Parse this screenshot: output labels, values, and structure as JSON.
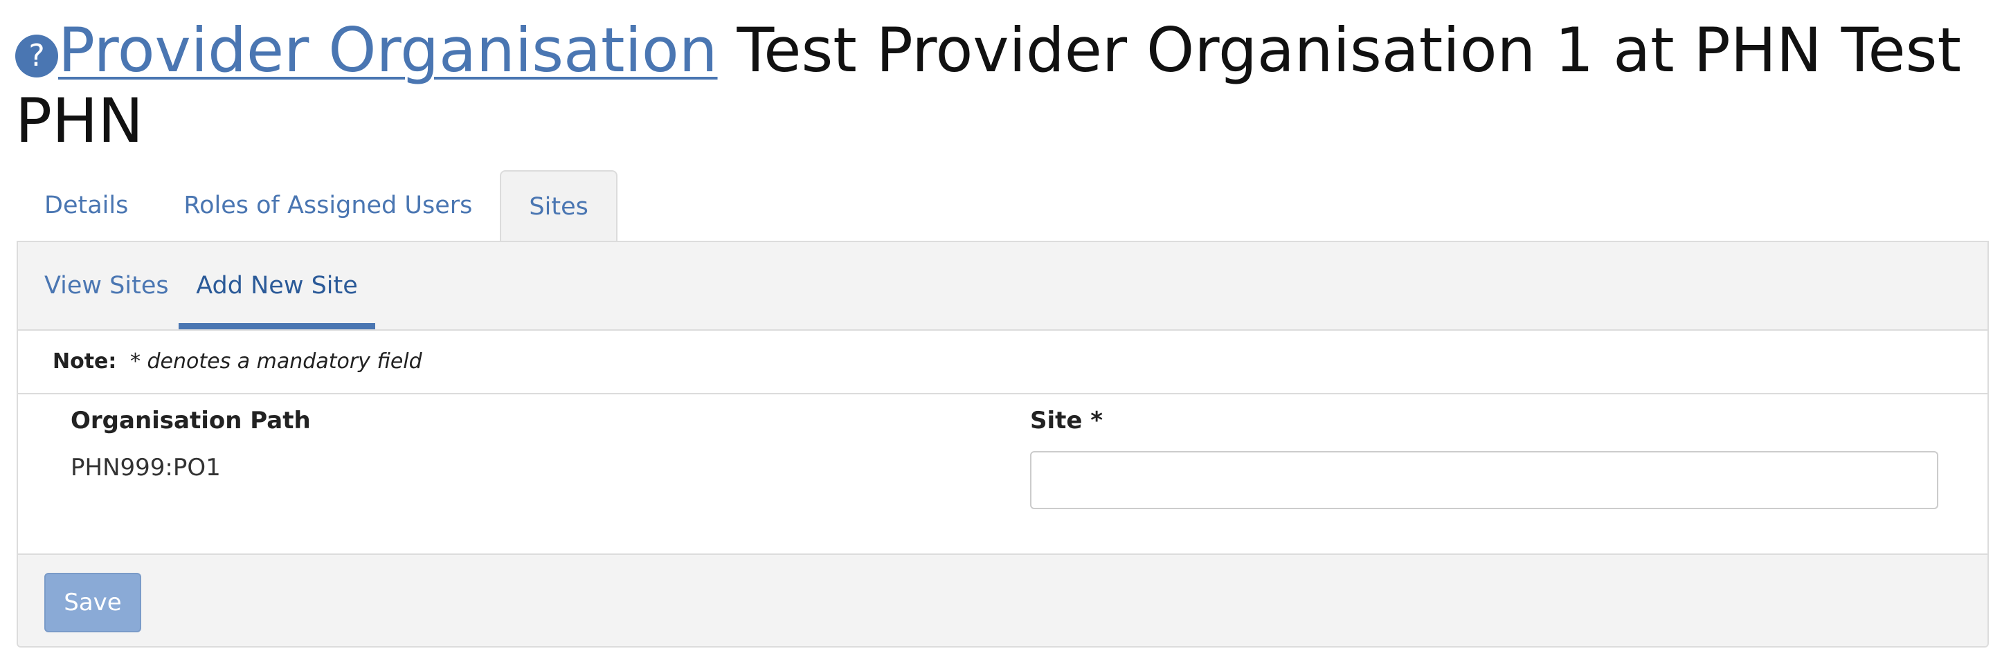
{
  "header": {
    "help_icon_glyph": "?",
    "entity_type_link": "Provider Organisation",
    "title_rest": " Test Provider Organisation 1 at PHN Test PHN"
  },
  "main_tabs": [
    {
      "label": "Details",
      "active": false
    },
    {
      "label": "Roles of Assigned Users",
      "active": false
    },
    {
      "label": "Sites",
      "active": true
    }
  ],
  "sub_tabs": [
    {
      "label": "View Sites",
      "active": false
    },
    {
      "label": "Add New Site",
      "active": true
    }
  ],
  "note": {
    "label": "Note:",
    "text": "* denotes a mandatory field"
  },
  "form": {
    "org_path_label": "Organisation Path",
    "org_path_value": "PHN999:PO1",
    "site_label": "Site *",
    "site_value": "",
    "site_placeholder": ""
  },
  "footer": {
    "save_label": "Save"
  },
  "colors": {
    "accent": "#4a76b2",
    "save_button_disabled": "#8aaad6",
    "panel_background": "#f3f3f3",
    "border": "#dcdcdc"
  },
  "icons": {
    "help": "help-icon"
  }
}
